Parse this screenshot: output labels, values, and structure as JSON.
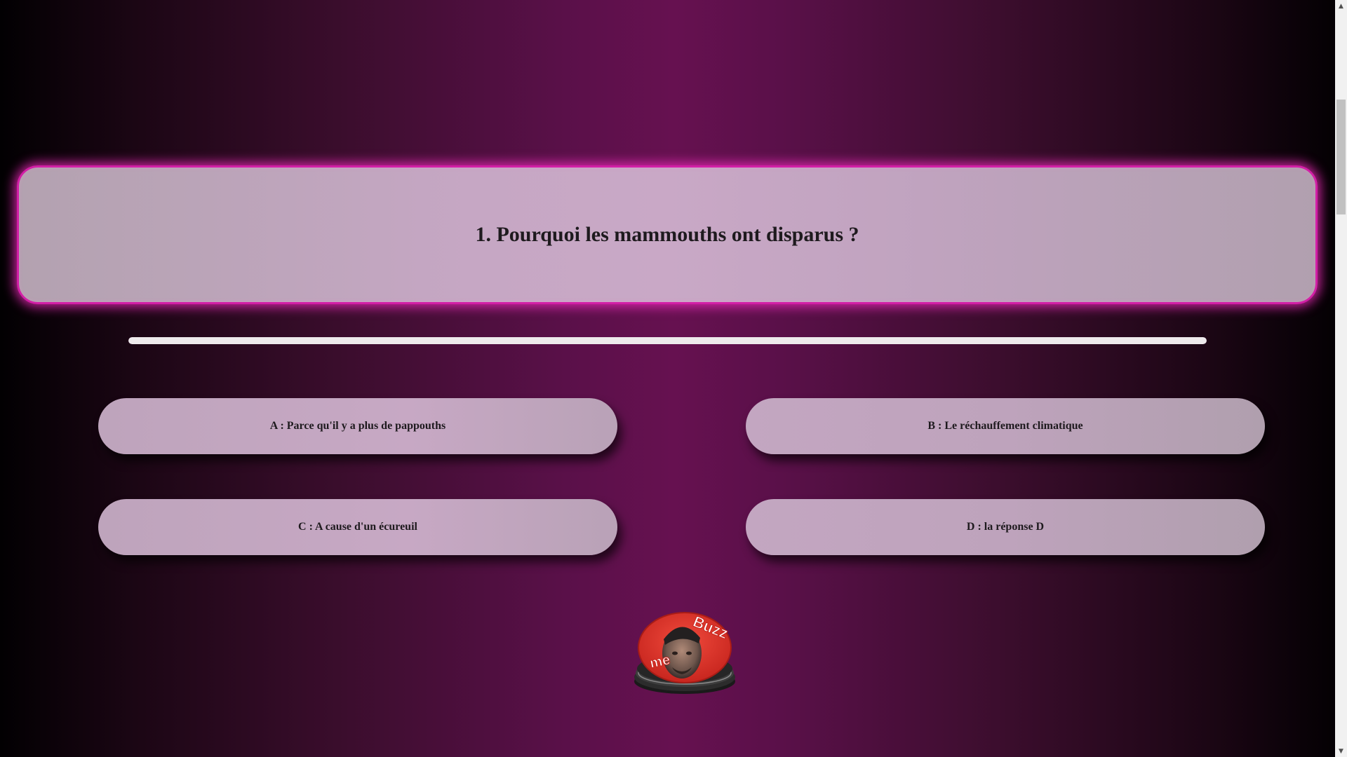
{
  "question": {
    "text": "1. Pourquoi les mammouths ont disparus ?"
  },
  "timer": {
    "remaining_fraction": 1.0
  },
  "answers": [
    {
      "letter": "A",
      "label": "A : Parce qu'il y a plus de pappouths"
    },
    {
      "letter": "B",
      "label": "B : Le réchauffement climatique"
    },
    {
      "letter": "C",
      "label": "C : A cause d'un écureuil"
    },
    {
      "letter": "D",
      "label": "D : la réponse D"
    }
  ],
  "buzzer": {
    "word_top": "Buzz",
    "word_bottom": "me"
  },
  "colors": {
    "background_center": "#661150",
    "question_border_glow": "#d21fa6",
    "answer_fill": "#c7a8c4",
    "timer_fill": "#eeeaec",
    "buzzer_red": "#e8352c"
  },
  "icons": {
    "scroll_up": "▲",
    "scroll_down": "▼"
  }
}
